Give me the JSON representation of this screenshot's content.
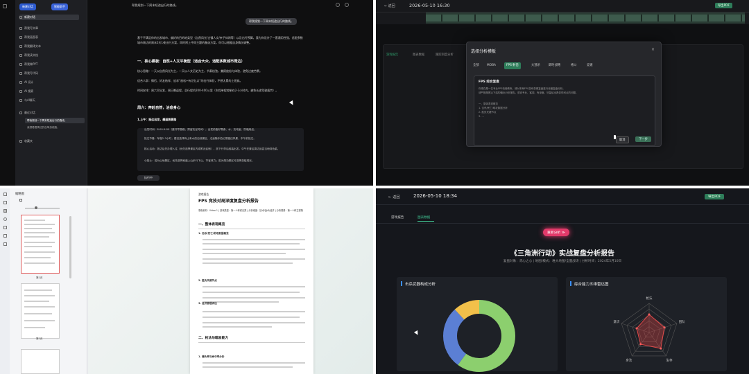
{
  "q1": {
    "btn_new": "新建对话",
    "btn_model": "智能助手",
    "top_title": "帮我规划一下周末短途出行的路线。",
    "nav": [
      "新建对话",
      "帮我写文章",
      "帮我画图表",
      "帮我翻译文本",
      "帮我读文档",
      "帮我做PPT",
      "帮我写代码",
      "AI 设计",
      "AI 搜索",
      "与AI聊天"
    ],
    "recent": "最近对话",
    "recent_items": [
      "帮我规划一下周末短途出行的路线。",
      "我想看看周边的自驾游线路。"
    ],
    "bottom": "收藏夹",
    "user_bubble": "帮我规划一下周末短途出行的路线。",
    "intro": "基于不满足你的出发城市、偏好的目的地类型（自然风光/古镇人文/亲子休闲等）以及出行预算，我为你设计了一套通用性强、适配多数城市周边的周末2天1夜出行方案，同时附上不同主题的备选方案，你可以根据自身情况调整。",
    "h1": "一、核心模板：自然+人文平衡型（适合大众，适配多数城市周边）",
    "p1": "核心思路：一天以自然风光为主，一天以人文历史为主，节奏松弛，兼顾放松与体验，避免过度劳累。",
    "p2": "适合人群：情侣、好友结伴、追求“放松+有记忆点”的出行体验，不想太累的上班族。",
    "p3": "时间安排：周六早出发，周日晚返程，总行程约200-400公里（车程单程控制在2-3小时内，避免长途驾驶疲劳）。",
    "h2": "周六：奔赴自然，治愈身心",
    "h3": "1.上午：抵达出发，邂逅美景路",
    "b1": "出发时间：8:00-9:00（避开早高峰，预留充足时间），出发前备好零食、水、充电宝、防晒用品。",
    "b2": "抵达节奏：车程2-3小时，建议选择有山有水的自然景区，沿途随手拍记录路边风景，中午前抵达。",
    "b3": "核心活动：抵达后先办理入住（优先选择景区内或附近民宿），放下行李后轻装出发，中午在景区周边品尝当地特色菜。",
    "b4": "小贴士：若为山地景区，优先选择索道上山步行下山，节省体力；若为湖泊景区可选择游船观光。",
    "status": "执行中"
  },
  "q2": {
    "back": "返回",
    "title": "2026-05-10 16:30",
    "export": "导出PDF",
    "tabs": [
      "游戏报告",
      "图表数据",
      "跟踪刻度分析"
    ],
    "modal_title": "选择分析模板",
    "close": "×",
    "modal_tabs": [
      "全部",
      "MOBA",
      "FPS 射击",
      "大逃杀",
      "即时战略",
      "格斗",
      "竞速"
    ],
    "card_title": "FPS 综合复盘",
    "card_lines": [
      "你现在是一名专业FPS电竞教练。请对本局FPS游戏录像复盘进行深度复盘分析。",
      "请严格按照以下结构输出分析报告，语言专业、客观、有深度，尽量给出具体时间点的问题。",
      "一、整体表现概览",
      "1. 击杀/死亡/助攻数据分析",
      "2. 胜负关键节点",
      "3. ..."
    ],
    "cancel": "取消",
    "next": "下一步"
  },
  "q3": {
    "panel_title": "缩略图",
    "page1": "第1页",
    "page2": "第2页",
    "doc_header": "游戏报告",
    "doc_title": "FPS 竞技对局深度复盘分析报告",
    "doc_meta": "录像素材：Video 1 | 游戏类型：第一人称射击类 | 分析维度：技术/战术/经济 | 分析视角：第一人称主视角",
    "s1": "一、整体表现概览",
    "s1a": "1. 击杀/死亡/助攻数据概览",
    "s1b": "2. 胜负关键节点",
    "s1c": "3. 经济管理评估",
    "s2": "二、枪法与瞄准能力",
    "s2a": "1. 爆头率与命中率分析"
  },
  "q4": {
    "back": "返回",
    "title": "2026-05-10 18:34",
    "export": "导出PDF",
    "tabs": [
      "游戏报告",
      "图表数据"
    ],
    "badge": "重新分析 ≫",
    "report_title": "《三角洲行动》实战复盘分析报告",
    "report_meta": "复盘对象：赤心之心 | 地图/模式：堆大地图/全面战场 | 分析时间：2024年5月10日",
    "card1": "击杀武器构成分析",
    "card2": "综合能力五维雷达图",
    "radar_labels": [
      "枪法",
      "团队",
      "身法",
      "生存",
      "意识"
    ]
  },
  "chart_data": {
    "donut": {
      "type": "pie",
      "title": "击杀武器构成分析",
      "values": [
        60,
        28,
        12
      ],
      "colors": [
        "#8ccf6e",
        "#5b7fd4",
        "#f2c04a"
      ]
    },
    "radar": {
      "type": "radar",
      "title": "综合能力五维雷达图",
      "axes": [
        "枪法",
        "团队",
        "生存",
        "身法",
        "意识"
      ],
      "values": [
        0.62,
        0.55,
        0.68,
        0.5,
        0.45
      ],
      "max": 1
    }
  }
}
